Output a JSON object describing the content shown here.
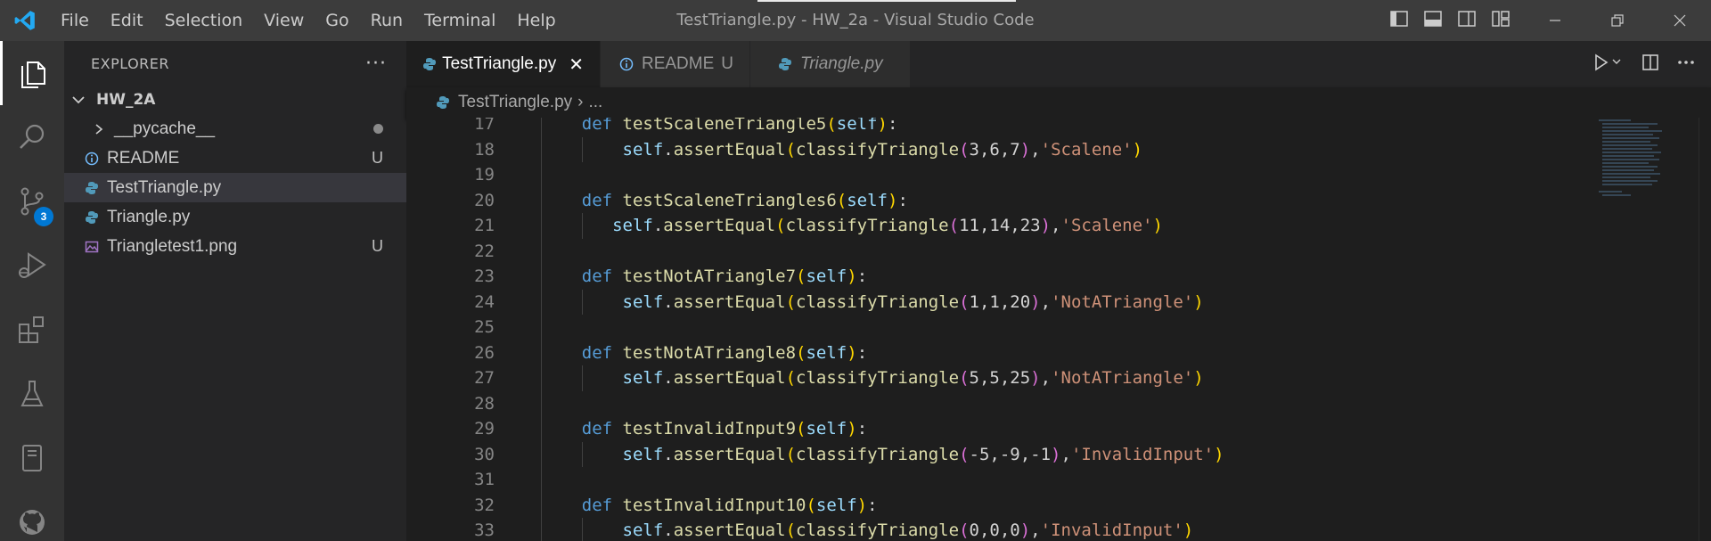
{
  "window": {
    "title": "TestTriangle.py - HW_2a - Visual Studio Code"
  },
  "menu": [
    "File",
    "Edit",
    "Selection",
    "View",
    "Go",
    "Run",
    "Terminal",
    "Help"
  ],
  "activity": {
    "source_control_badge": "3"
  },
  "explorer": {
    "header": "EXPLORER",
    "more": "···",
    "folder": "HW_2A",
    "items": [
      {
        "name": "__pycache__",
        "type": "folder",
        "status": ""
      },
      {
        "name": "README",
        "type": "info",
        "status": "U"
      },
      {
        "name": "TestTriangle.py",
        "type": "python",
        "status": ""
      },
      {
        "name": "Triangle.py",
        "type": "python",
        "status": ""
      },
      {
        "name": "Triangletest1.png",
        "type": "image",
        "status": "U"
      }
    ]
  },
  "tabs": [
    {
      "label": "TestTriangle.py",
      "active": true,
      "close": "✕"
    },
    {
      "label": "README",
      "status": "U"
    },
    {
      "label": "Triangle.py"
    }
  ],
  "breadcrumb": {
    "file": "TestTriangle.py",
    "sep": "›",
    "rest": "..."
  },
  "code": {
    "lines": [
      {
        "n": "17",
        "indent": "def",
        "text": "def testScaleneTriangle5(self):",
        "name": "testScaleneTriangle5"
      },
      {
        "n": "18",
        "indent": "body",
        "a": "3",
        "b": "6",
        "c": "7",
        "expect": "'Scalene'"
      },
      {
        "n": "19"
      },
      {
        "n": "20",
        "indent": "def",
        "name": "testScaleneTriangles6"
      },
      {
        "n": "21",
        "indent": "body2",
        "a": "11",
        "b": "14",
        "c": "23",
        "expect": "'Scalene'"
      },
      {
        "n": "22"
      },
      {
        "n": "23",
        "indent": "def",
        "name": "testNotATriangle7"
      },
      {
        "n": "24",
        "indent": "body",
        "a": "1",
        "b": "1",
        "c": "20",
        "expect": "'NotATriangle'"
      },
      {
        "n": "25"
      },
      {
        "n": "26",
        "indent": "def",
        "name": "testNotATriangle8"
      },
      {
        "n": "27",
        "indent": "body",
        "a": "5",
        "b": "5",
        "c": "25",
        "expect": "'NotATriangle'"
      },
      {
        "n": "28"
      },
      {
        "n": "29",
        "indent": "def",
        "name": "testInvalidInput9"
      },
      {
        "n": "30",
        "indent": "body",
        "a": "-5",
        "b": "-9",
        "c": "-1",
        "expect": "'InvalidInput'"
      },
      {
        "n": "31"
      },
      {
        "n": "32",
        "indent": "def",
        "name": "testInvalidInput10"
      },
      {
        "n": "33",
        "indent": "body",
        "a": "0",
        "b": "0",
        "c": "0",
        "expect": "'InvalidInput'"
      }
    ],
    "keyword": "def",
    "self": "self",
    "assert": "assertEqual",
    "call": "classifyTriangle"
  },
  "colors": {
    "accent": "#0078d4",
    "keyword": "#569cd6",
    "function": "#dcdcaa",
    "string": "#ce9178"
  }
}
